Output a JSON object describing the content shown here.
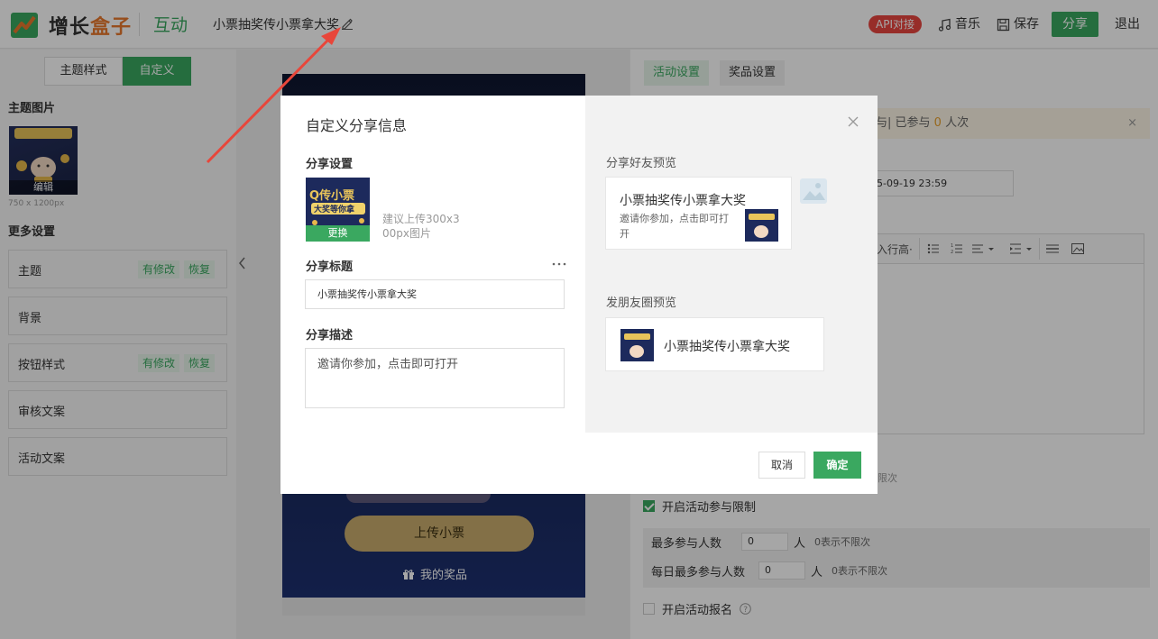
{
  "brand": {
    "name_a": "增长",
    "name_b": "盒子",
    "section": "互动"
  },
  "activity": {
    "title": "小票抽奖传小票拿大奖"
  },
  "toolbar": {
    "api": "API对接",
    "music": "音乐",
    "save": "保存",
    "share": "分享",
    "exit": "退出"
  },
  "left": {
    "tabs": [
      "主题样式",
      "自定义"
    ],
    "theme_image_heading": "主题图片",
    "theme_image_edit": "编辑",
    "theme_image_size": "750 x 1200px",
    "more_heading": "更多设置",
    "items": [
      {
        "label": "主题",
        "modified": "有修改",
        "restore": "恢复"
      },
      {
        "label": "背景"
      },
      {
        "label": "按钮样式",
        "modified": "有修改",
        "restore": "恢复"
      },
      {
        "label": "审核文案"
      },
      {
        "label": "活动文案"
      }
    ]
  },
  "preview": {
    "upload_btn": "上传小票",
    "prize_link": "我的奖品"
  },
  "right": {
    "tabs": [
      "活动设置",
      "奖品设置"
    ],
    "notice_pre": "与| 已参与 ",
    "notice_num": "0",
    "notice_post": " 人次",
    "date_value": "5-09-19 23:59",
    "editor_lineheight": "入行高·",
    "limit_hint_top": "限次",
    "participation_limit_label": "开启活动参与限制",
    "max_people_label": "最多参与人数",
    "max_people_value": "0",
    "max_people_unit": "人",
    "max_people_hint": "0表示不限次",
    "daily_max_label": "每日最多参与人数",
    "daily_max_value": "0",
    "daily_max_unit": "人",
    "daily_max_hint": "0表示不限次",
    "signup_label": "开启活动报名"
  },
  "modal": {
    "title": "自定义分享信息",
    "share_settings_label": "分享设置",
    "replace_btn": "更换",
    "upload_hint": "建议上传300x300px图片",
    "share_title_label": "分享标题",
    "share_title_value": "小票抽奖传小票拿大奖",
    "share_desc_label": "分享描述",
    "share_desc_value": "邀请你参加，点击即可打开",
    "friend_preview_label": "分享好友预览",
    "friend_card_title": "小票抽奖传小票拿大奖",
    "friend_card_desc": "邀请你参加，点击即可打开",
    "moments_preview_label": "发朋友圈预览",
    "moments_card_title": "小票抽奖传小票拿大奖",
    "cancel": "取消",
    "confirm": "确定"
  },
  "thumb_text": {
    "line1": "Q传小票",
    "line2": "大奖等你拿"
  },
  "colors": {
    "accent": "#3aa860",
    "brand_orange": "#e8792d",
    "danger": "#e9463f",
    "annotation_arrow": "#e8463a"
  }
}
